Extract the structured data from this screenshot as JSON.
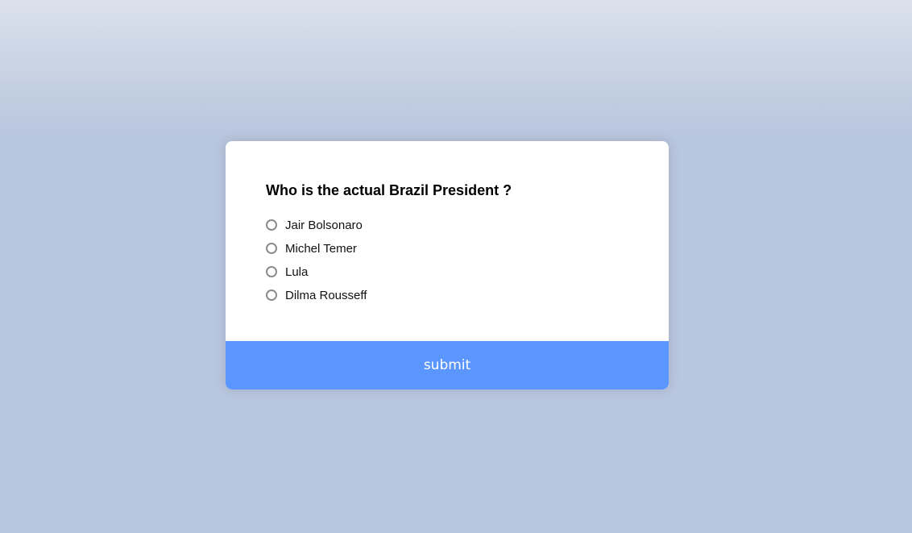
{
  "quiz": {
    "question": "Who is the actual Brazil President ?",
    "answers": [
      {
        "label": "Jair Bolsonaro"
      },
      {
        "label": "Michel Temer"
      },
      {
        "label": "Lula"
      },
      {
        "label": "Dilma Rousseff"
      }
    ],
    "submit_label": "submit"
  },
  "colors": {
    "background": "#b8c6de",
    "card": "#ffffff",
    "submit_button": "#5b96ff"
  }
}
